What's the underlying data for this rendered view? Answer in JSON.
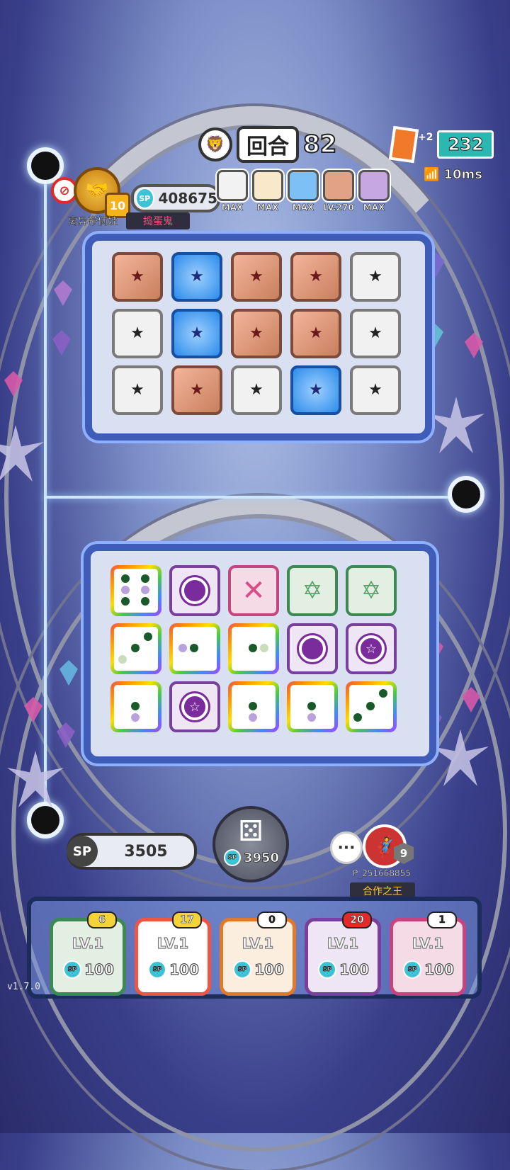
{
  "header": {
    "round_label": "回合",
    "round_number": "82",
    "card_plus": "+2",
    "card_count": "232",
    "ping": "10ms"
  },
  "opponent": {
    "sp_value": "408675",
    "name": "离异带俩娃",
    "tag": "捣蛋鬼",
    "guild_level": "10",
    "deck": [
      {
        "label": "MAX",
        "color": "#f2f2f2"
      },
      {
        "label": "MAX",
        "color": "#f7e9c9"
      },
      {
        "label": "MAX",
        "color": "#7cc0f5"
      },
      {
        "label": "LV.270",
        "color": "#e2a286"
      },
      {
        "label": "MAX",
        "color": "#c6a7e2"
      }
    ]
  },
  "player": {
    "sp_label": "SP",
    "sp_value": "3505",
    "summon_cost": "3950",
    "ally_name": "P_251668855",
    "ally_level": "9",
    "ally_title": "合作之王",
    "deck": [
      {
        "level": "LV.1",
        "cost": "100",
        "badge": "6",
        "color": "green"
      },
      {
        "level": "LV.1",
        "cost": "100",
        "badge": "17",
        "color": "rainbow"
      },
      {
        "level": "LV.1",
        "cost": "100",
        "badge": "0",
        "color": "orange"
      },
      {
        "level": "LV.1",
        "cost": "100",
        "badge": "20",
        "color": "purple"
      },
      {
        "level": "LV.1",
        "cost": "100",
        "badge": "1",
        "color": "pink"
      }
    ]
  },
  "sp_badge_text": "SP",
  "version": "v1.7.0"
}
